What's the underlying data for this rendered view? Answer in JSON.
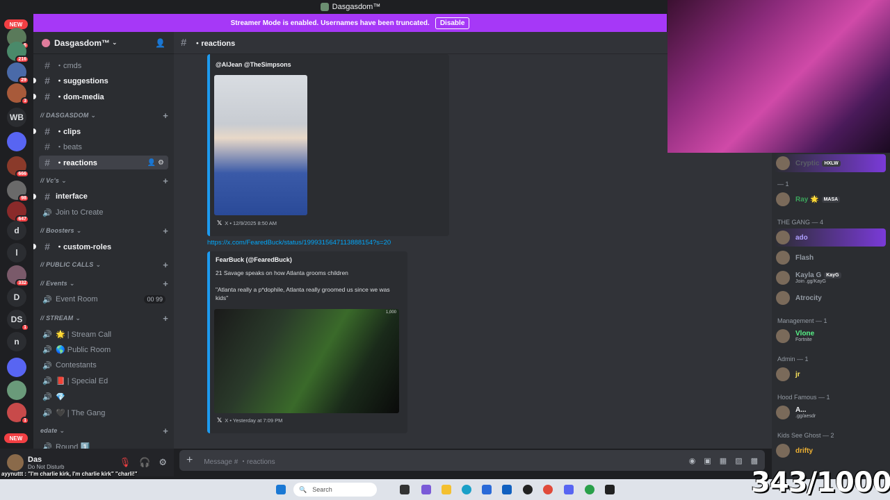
{
  "window_title": "Dasgasdom™",
  "banner": {
    "text": "Streamer Mode is enabled. Usernames have been truncated.",
    "button": "Disable"
  },
  "servers": {
    "new_top": "NEW",
    "new_bottom": "NEW",
    "items": [
      {
        "label": "",
        "badge": "6"
      },
      {
        "label": "",
        "badge": "216"
      },
      {
        "label": "",
        "badge": "29"
      },
      {
        "label": "",
        "badge": "3"
      },
      {
        "label": "WB",
        "badge": ""
      },
      {
        "label": "",
        "badge": ""
      },
      {
        "label": "",
        "badge": "666"
      },
      {
        "label": "",
        "badge": "98"
      },
      {
        "label": "",
        "badge": "647"
      },
      {
        "label": "d",
        "badge": ""
      },
      {
        "label": "l",
        "badge": ""
      },
      {
        "label": "",
        "badge": "332"
      },
      {
        "label": "D",
        "badge": ""
      },
      {
        "label": "DS",
        "badge": "1"
      },
      {
        "label": "n",
        "badge": ""
      },
      {
        "label": "",
        "badge": ""
      },
      {
        "label": "",
        "badge": ""
      },
      {
        "label": "",
        "badge": "1"
      }
    ]
  },
  "guild": {
    "name": "Dasgasdom™"
  },
  "channels": [
    {
      "type": "text",
      "name": "・cmds",
      "state": "muted"
    },
    {
      "type": "text",
      "name": "・suggestions",
      "state": "unread"
    },
    {
      "type": "text",
      "name": "・dom-media",
      "state": "unread"
    },
    {
      "type": "cat",
      "name": "// DASGASDOM"
    },
    {
      "type": "text",
      "name": "・clips",
      "state": "unread"
    },
    {
      "type": "text",
      "name": "・beats",
      "state": "muted"
    },
    {
      "type": "text",
      "name": "・reactions",
      "state": "selected"
    },
    {
      "type": "cat",
      "name": "// Vc's"
    },
    {
      "type": "text",
      "name": "interface",
      "state": "unread"
    },
    {
      "type": "voice",
      "name": "Join to Create",
      "state": "muted"
    },
    {
      "type": "cat",
      "name": "// Boosters"
    },
    {
      "type": "text",
      "name": "・custom-roles",
      "state": "unread"
    },
    {
      "type": "cat",
      "name": "// PUBLIC CALLS"
    },
    {
      "type": "cat",
      "name": "// Events"
    },
    {
      "type": "voice",
      "name": "Event Room",
      "state": "muted",
      "count": "00  99"
    },
    {
      "type": "cat",
      "name": "// STREAM"
    },
    {
      "type": "voice",
      "name": "🌟 | Stream Call",
      "state": "muted"
    },
    {
      "type": "voice",
      "name": "🌎 Public Room",
      "state": "muted"
    },
    {
      "type": "voice",
      "name": "Contestants",
      "state": "muted"
    },
    {
      "type": "voice",
      "name": "📕 | Special Ed",
      "state": "muted"
    },
    {
      "type": "voice",
      "name": "💎",
      "state": "muted"
    },
    {
      "type": "voice",
      "name": "🖤 | The Gang",
      "state": "muted"
    },
    {
      "type": "cat",
      "name": "edate"
    },
    {
      "type": "voice",
      "name": "Round 1️⃣",
      "state": "muted"
    }
  ],
  "user": {
    "name": "Das",
    "status": "Do Not Disturb"
  },
  "chat_header": {
    "channel": "・reactions"
  },
  "messages": {
    "embed1": {
      "author": "@AlJean @TheSimpsons",
      "footer": "X • 12/9/2025 8:50 AM"
    },
    "link": "https://x.com/FearedBuck/status/1999315647113888154?s=20",
    "embed2": {
      "author": "FearBuck (@FearedBuck)",
      "line1": "21 Savage speaks on how Atlanta grooms children",
      "line2": "\"Atlanta really a p*dophile, Atlanta really groomed us since we was kids\"",
      "footer": "X • Yesterday at 7:09 PM",
      "overlay": "1,000"
    }
  },
  "composer": {
    "placeholder": "Message # ・reactions"
  },
  "members": {
    "top": {
      "name": "Cryptic",
      "tag": "HXLW"
    },
    "groups": [
      {
        "header": "— 1",
        "members": [
          {
            "name": "Ray 🌟",
            "tag": "MASA",
            "color": "#3ba55c",
            "status": ""
          }
        ]
      },
      {
        "header": "THE GANG — 4",
        "members": [
          {
            "name": "ado",
            "tag": "",
            "color": "#b0a0ff",
            "status": ""
          },
          {
            "name": "Flash",
            "tag": "",
            "color": "#949ba4",
            "status": ""
          },
          {
            "name": "Kayla G",
            "tag": "KayG",
            "color": "#949ba4",
            "status": "Join .gg/KayG"
          },
          {
            "name": "Atrocity",
            "tag": "",
            "color": "#949ba4",
            "status": ""
          }
        ]
      },
      {
        "header": "Management — 1",
        "members": [
          {
            "name": "Vlone",
            "tag": "",
            "color": "#57f287",
            "status": "Fortnite"
          }
        ]
      },
      {
        "header": "Admin — 1",
        "members": [
          {
            "name": "jr",
            "tag": "",
            "color": "#fee75c",
            "status": ""
          }
        ]
      },
      {
        "header": "Hood Famous — 1",
        "members": [
          {
            "name": "A...",
            "tag": "",
            "color": "#f2f3f5",
            "status": ".gg/aesdr"
          }
        ]
      },
      {
        "header": "Kids See Ghost — 2",
        "members": [
          {
            "name": "drifty",
            "tag": "",
            "color": "#f0b232",
            "status": ""
          }
        ]
      }
    ]
  },
  "overlay": {
    "counter": "343/1000",
    "ticker": "ayynuttt : \"I'm charlie kirk, I'm charlie kirk\" \"charli!\""
  },
  "taskbar": {
    "search": "Search"
  },
  "colors": {
    "accent": "#a638f7",
    "link": "#00a8fc",
    "twitter": "#1d9bf0"
  }
}
